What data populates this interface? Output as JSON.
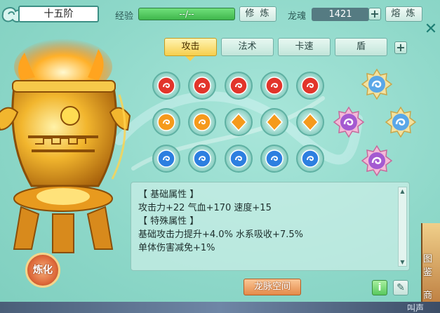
{
  "header": {
    "rank": "十五阶",
    "exp_label": "经验",
    "exp_value": "--/--",
    "exp_fill": 1.0,
    "train_button": "修 炼",
    "soul_label": "龙魂",
    "soul_value": "1421",
    "smelt_button": "熔 炼"
  },
  "tabs": [
    {
      "label": "攻击",
      "active": true
    },
    {
      "label": "法术",
      "active": false
    },
    {
      "label": "卡速",
      "active": false
    },
    {
      "label": "盾",
      "active": false
    }
  ],
  "gems": {
    "rows": [
      {
        "color": "red",
        "count": 5,
        "hex": "#e2352b"
      },
      {
        "color": "orange",
        "count": 5,
        "hex": "#f59a1c"
      },
      {
        "color": "blue",
        "count": 5,
        "hex": "#2d7fe0"
      }
    ]
  },
  "refine_button": "炼化",
  "attributes": {
    "lines": [
      "【 基础属性 】",
      "攻击力+22  气血+170  速度+15",
      "【 特殊属性 】",
      "基础攻击力提升+4.0%  水系吸收+7.5%",
      "单体伤害减免+1%"
    ]
  },
  "dragon_space_button": "龙脉空间",
  "side_menu": {
    "item1": "图鉴",
    "item2": "商店"
  },
  "bottom_text": "叫声"
}
